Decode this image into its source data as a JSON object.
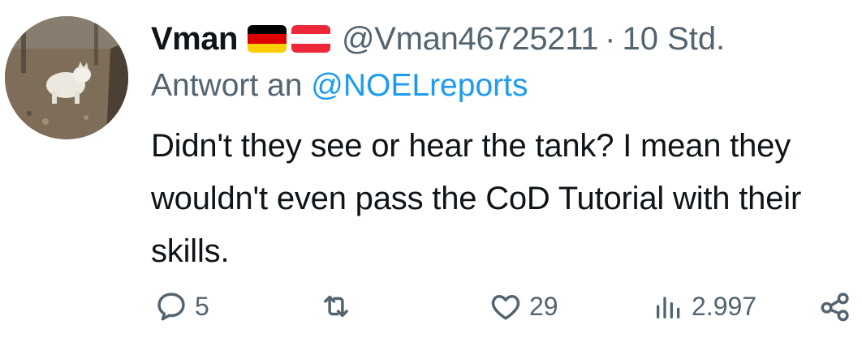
{
  "tweet": {
    "display_name": "Vman",
    "flags": [
      "de-flag-icon",
      "at-flag-icon"
    ],
    "handle": "@Vman46725211",
    "separator": "·",
    "time": "10 Std.",
    "reply_prefix": "Antwort an",
    "reply_mention": "@NOELreports",
    "text": "Didn't they see or hear the tank? I mean they wouldn't even pass the CoD Tutorial with their skills."
  },
  "actions": {
    "replies": "5",
    "retweets": "",
    "likes": "29",
    "views": "2.997"
  },
  "colors": {
    "text": "#0f1419",
    "secondary": "#536471",
    "link": "#1d9bf0",
    "de_black": "#000000",
    "de_red": "#dd0000",
    "de_gold": "#ffce00",
    "at_red": "#ed2939",
    "at_white": "#ffffff"
  }
}
